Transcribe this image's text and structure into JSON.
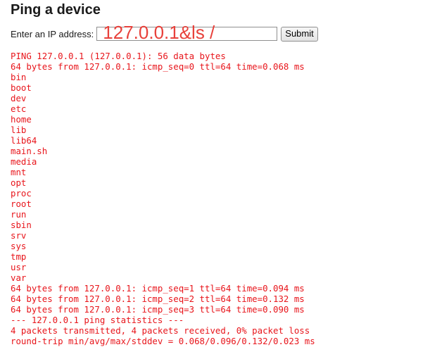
{
  "page": {
    "title": "Ping a device"
  },
  "form": {
    "label": "Enter an IP address:",
    "input_value": "127.0.0.1&ls /",
    "submit_label": "Submit"
  },
  "output": {
    "lines": [
      "PING 127.0.0.1 (127.0.0.1): 56 data bytes",
      "64 bytes from 127.0.0.1: icmp_seq=0 ttl=64 time=0.068 ms",
      "bin",
      "boot",
      "dev",
      "etc",
      "home",
      "lib",
      "lib64",
      "main.sh",
      "media",
      "mnt",
      "opt",
      "proc",
      "root",
      "run",
      "sbin",
      "srv",
      "sys",
      "tmp",
      "usr",
      "var",
      "64 bytes from 127.0.0.1: icmp_seq=1 ttl=64 time=0.094 ms",
      "64 bytes from 127.0.0.1: icmp_seq=2 ttl=64 time=0.132 ms",
      "64 bytes from 127.0.0.1: icmp_seq=3 ttl=64 time=0.090 ms",
      "--- 127.0.0.1 ping statistics ---",
      "4 packets transmitted, 4 packets received, 0% packet loss",
      "round-trip min/avg/max/stddev = 0.068/0.096/0.132/0.023 ms"
    ]
  },
  "colors": {
    "output_text": "#e8151b",
    "input_text": "#e8413b"
  }
}
